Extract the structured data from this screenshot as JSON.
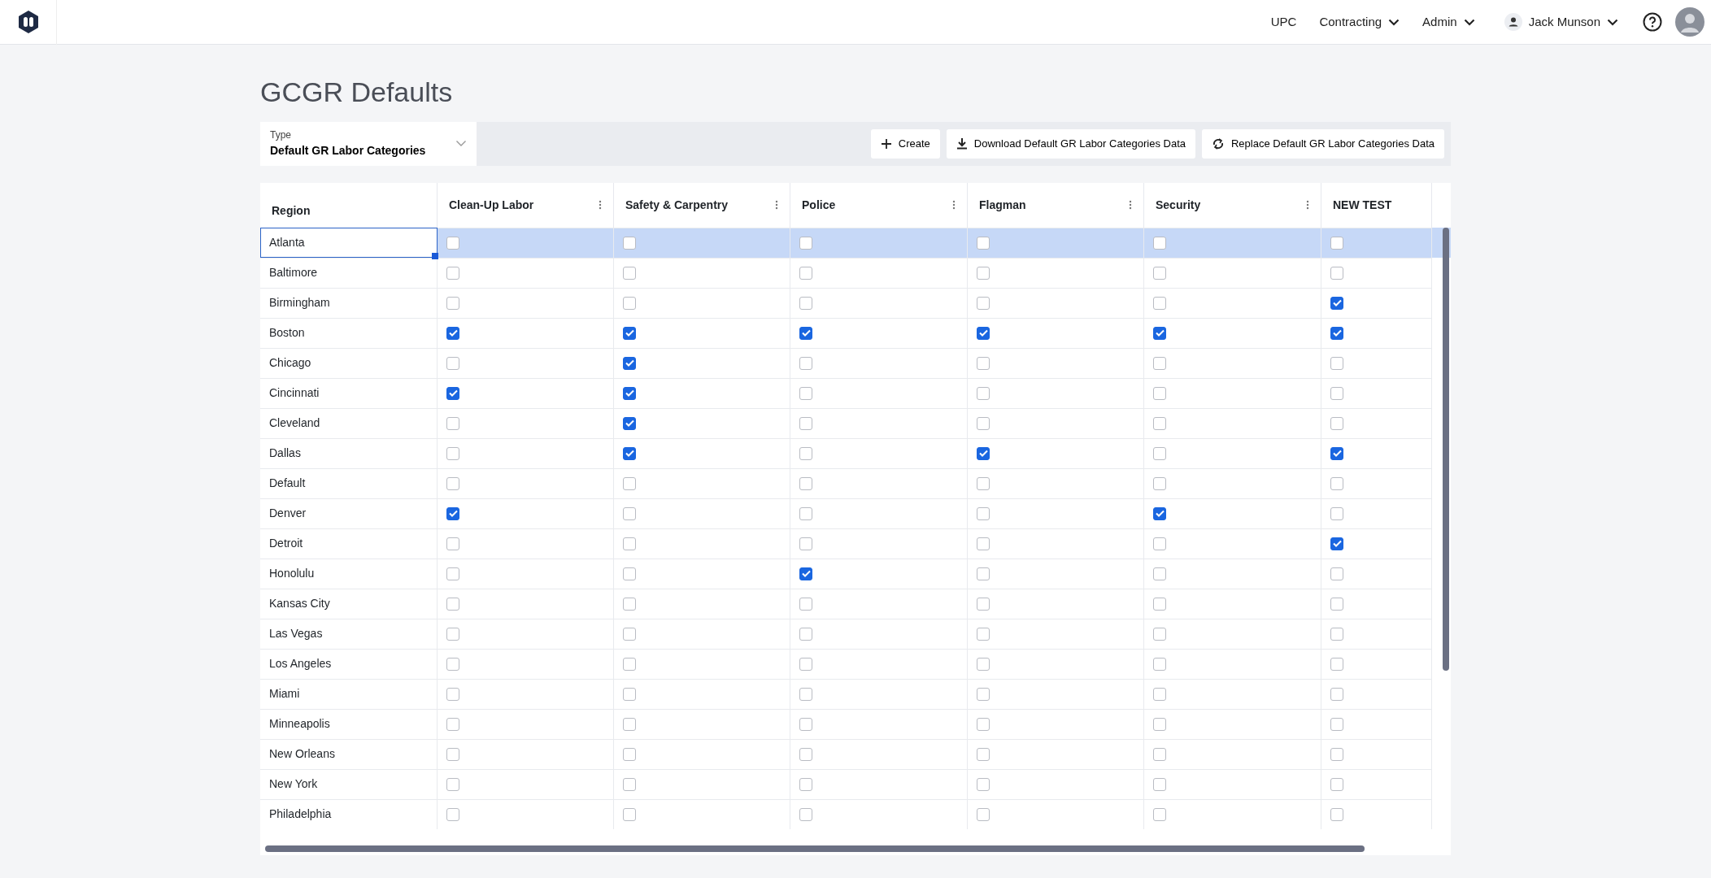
{
  "nav": {
    "items": [
      {
        "label": "UPC",
        "dropdown": false
      },
      {
        "label": "Contracting",
        "dropdown": true
      },
      {
        "label": "Admin",
        "dropdown": true
      }
    ],
    "user": "Jack Munson"
  },
  "title": "GCGR Defaults",
  "type_select": {
    "label": "Type",
    "value": "Default GR Labor Categories"
  },
  "actions": [
    {
      "kind": "create",
      "label": "Create"
    },
    {
      "kind": "download",
      "label": "Download Default GR Labor Categories Data"
    },
    {
      "kind": "replace",
      "label": "Replace Default GR Labor Categories Data"
    }
  ],
  "table": {
    "columns": [
      {
        "label": "Region",
        "menu": false
      },
      {
        "label": "Clean-Up Labor",
        "menu": true
      },
      {
        "label": "Safety & Carpentry",
        "menu": true
      },
      {
        "label": "Police",
        "menu": true
      },
      {
        "label": "Flagman",
        "menu": true
      },
      {
        "label": "Security",
        "menu": true
      },
      {
        "label": "NEW TEST",
        "menu": false
      }
    ],
    "rows": [
      {
        "region": "Atlanta",
        "selected": true,
        "checks": [
          false,
          false,
          false,
          false,
          false,
          false
        ]
      },
      {
        "region": "Baltimore",
        "selected": false,
        "checks": [
          false,
          false,
          false,
          false,
          false,
          false
        ]
      },
      {
        "region": "Birmingham",
        "selected": false,
        "checks": [
          false,
          false,
          false,
          false,
          false,
          true
        ]
      },
      {
        "region": "Boston",
        "selected": false,
        "checks": [
          true,
          true,
          true,
          true,
          true,
          true
        ]
      },
      {
        "region": "Chicago",
        "selected": false,
        "checks": [
          false,
          true,
          false,
          false,
          false,
          false
        ]
      },
      {
        "region": "Cincinnati",
        "selected": false,
        "checks": [
          true,
          true,
          false,
          false,
          false,
          false
        ]
      },
      {
        "region": "Cleveland",
        "selected": false,
        "checks": [
          false,
          true,
          false,
          false,
          false,
          false
        ]
      },
      {
        "region": "Dallas",
        "selected": false,
        "checks": [
          false,
          true,
          false,
          true,
          false,
          true
        ]
      },
      {
        "region": "Default",
        "selected": false,
        "checks": [
          false,
          false,
          false,
          false,
          false,
          false
        ]
      },
      {
        "region": "Denver",
        "selected": false,
        "checks": [
          true,
          false,
          false,
          false,
          true,
          false
        ]
      },
      {
        "region": "Detroit",
        "selected": false,
        "checks": [
          false,
          false,
          false,
          false,
          false,
          true
        ]
      },
      {
        "region": "Honolulu",
        "selected": false,
        "checks": [
          false,
          false,
          true,
          false,
          false,
          false
        ]
      },
      {
        "region": "Kansas City",
        "selected": false,
        "checks": [
          false,
          false,
          false,
          false,
          false,
          false
        ]
      },
      {
        "region": "Las Vegas",
        "selected": false,
        "checks": [
          false,
          false,
          false,
          false,
          false,
          false
        ]
      },
      {
        "region": "Los Angeles",
        "selected": false,
        "checks": [
          false,
          false,
          false,
          false,
          false,
          false
        ]
      },
      {
        "region": "Miami",
        "selected": false,
        "checks": [
          false,
          false,
          false,
          false,
          false,
          false
        ]
      },
      {
        "region": "Minneapolis",
        "selected": false,
        "checks": [
          false,
          false,
          false,
          false,
          false,
          false
        ]
      },
      {
        "region": "New Orleans",
        "selected": false,
        "checks": [
          false,
          false,
          false,
          false,
          false,
          false
        ]
      },
      {
        "region": "New York",
        "selected": false,
        "checks": [
          false,
          false,
          false,
          false,
          false,
          false
        ]
      },
      {
        "region": "Philadelphia",
        "selected": false,
        "checks": [
          false,
          false,
          false,
          false,
          false,
          false
        ]
      }
    ]
  }
}
